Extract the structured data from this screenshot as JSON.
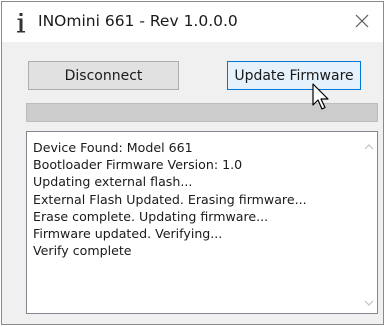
{
  "window": {
    "title": "INOmini 661 - Rev 1.0.0.0"
  },
  "buttons": {
    "disconnect_label": "Disconnect",
    "update_firmware_label": "Update Firmware"
  },
  "progress": {
    "value_percent": 0
  },
  "log": {
    "lines": [
      "Device Found: Model 661",
      "Bootloader Firmware Version: 1.0",
      "Updating external flash...",
      "External Flash Updated. Erasing firmware...",
      "Erase complete. Updating firmware...",
      "Firmware updated. Verifying...",
      "Verify complete"
    ]
  },
  "icons": {
    "app": "info-icon",
    "close": "close-icon",
    "scroll_up": "chevron-up-icon",
    "scroll_down": "chevron-down-icon",
    "cursor": "mouse-cursor-icon"
  },
  "colors": {
    "window_bg": "#f0f0f0",
    "progress_track": "#cccccc",
    "progress_fill": "#06b025",
    "button_hover_border": "#0078d7"
  }
}
